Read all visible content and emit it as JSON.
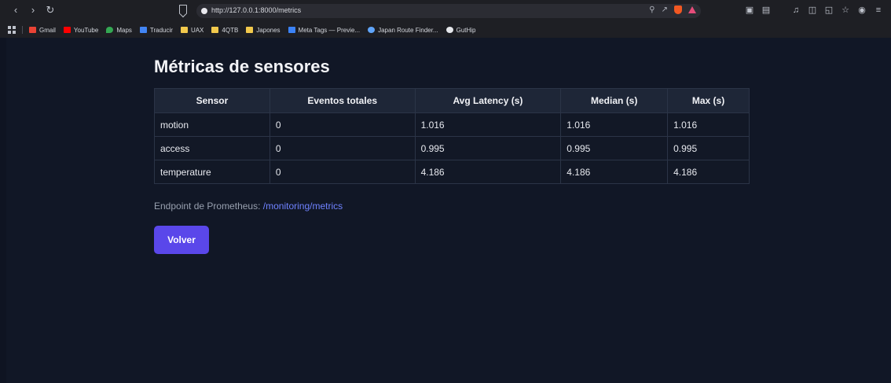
{
  "browser": {
    "url": "http://127.0.0.1:8000/metrics",
    "bookmarks": [
      {
        "label": "Gmail",
        "color": "#ea4335"
      },
      {
        "label": "YouTube",
        "color": "#ff0000"
      },
      {
        "label": "Maps",
        "color": "#34a853"
      },
      {
        "label": "Traducir",
        "color": "#4285f4"
      },
      {
        "label": "UAX",
        "color": "#f2c94c"
      },
      {
        "label": "4QTB",
        "color": "#f2c94c"
      },
      {
        "label": "Japones",
        "color": "#f2c94c"
      },
      {
        "label": "Meta Tags — Previe...",
        "color": "#3b82f6"
      },
      {
        "label": "Japan Route Finder...",
        "color": "#60a5fa"
      },
      {
        "label": "GutHip",
        "color": "#e5e7eb"
      }
    ]
  },
  "page": {
    "title": "Métricas de sensores",
    "table": {
      "headers": [
        "Sensor",
        "Eventos totales",
        "Avg Latency (s)",
        "Median (s)",
        "Max (s)"
      ],
      "rows": [
        [
          "motion",
          "0",
          "1.016",
          "1.016",
          "1.016"
        ],
        [
          "access",
          "0",
          "0.995",
          "0.995",
          "0.995"
        ],
        [
          "temperature",
          "0",
          "4.186",
          "4.186",
          "4.186"
        ]
      ]
    },
    "endpoint_label": "Endpoint de Prometheus: ",
    "endpoint_link": "/monitoring/metrics",
    "back_button": "Volver"
  },
  "colors": {
    "accent": "#5a47ea",
    "link": "#6f82ff",
    "background": "#111726"
  }
}
